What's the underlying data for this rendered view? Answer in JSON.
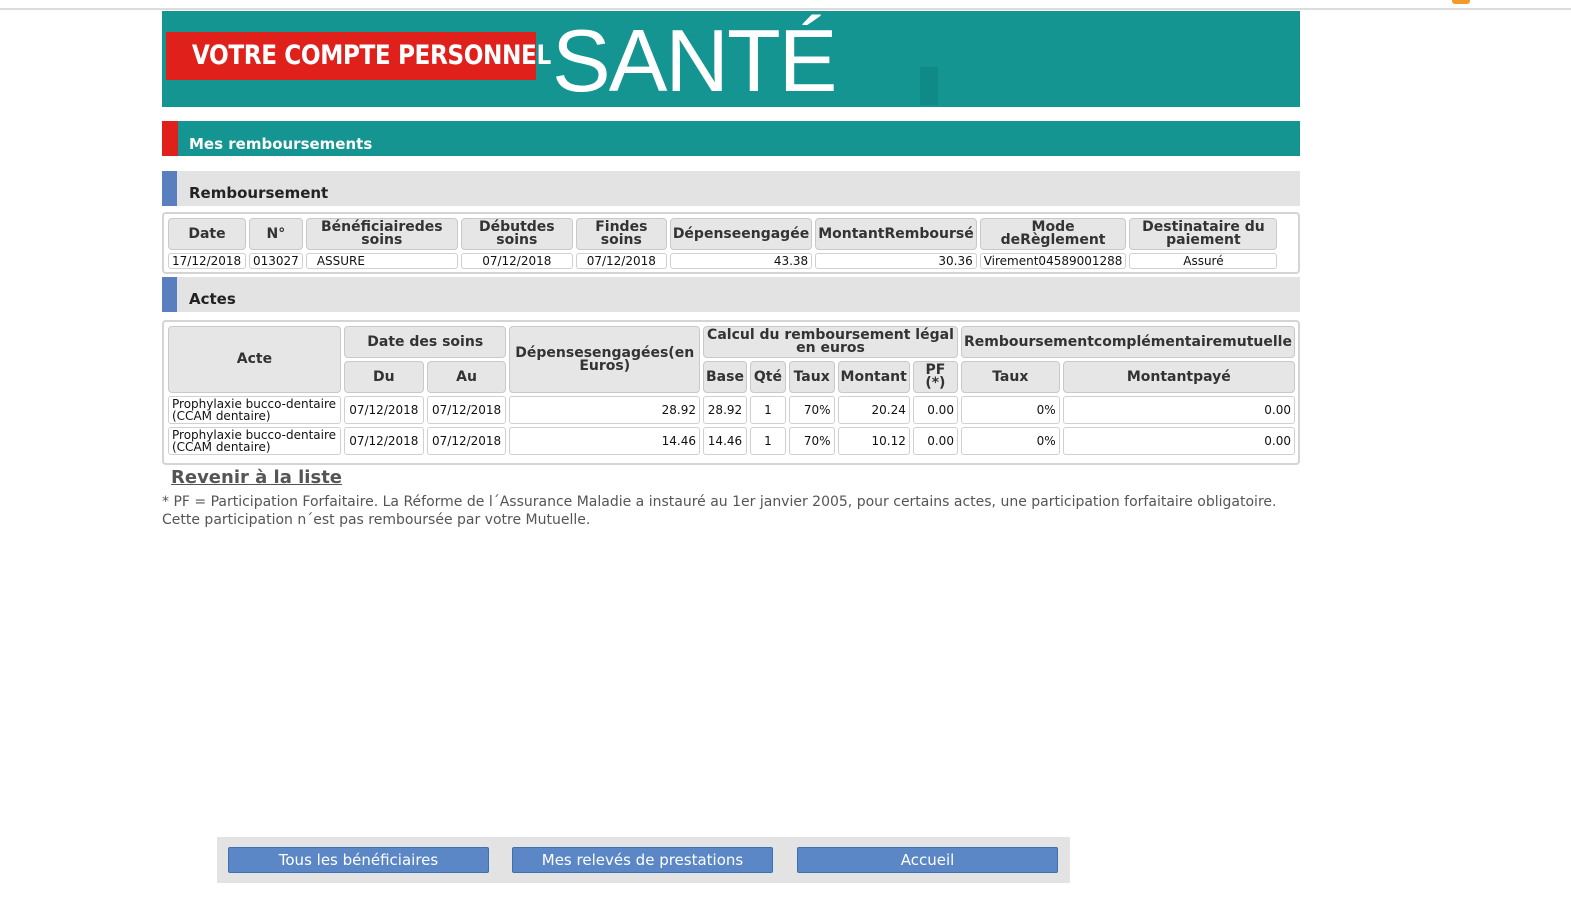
{
  "banner": {
    "compte_label": "VOTRE COMPTE PERSONNEL",
    "sante_label": "SANTÉ"
  },
  "section_main": "Mes remboursements",
  "section_remboursement": "Remboursement",
  "section_actes": "Actes",
  "remboursement": {
    "headers": [
      "Date",
      "N°",
      "Bénéficiairedes soins",
      "Débutdes soins",
      "Findes soins",
      "Dépenseengagée",
      "MontantRemboursé",
      "Mode deRèglement",
      "Destinataire du paiement"
    ],
    "row": [
      "17/12/2018",
      "013027",
      "ASSURE",
      "07/12/2018",
      "07/12/2018",
      "43.38",
      "30.36",
      "Virement04589001288",
      "Assuré"
    ]
  },
  "actes": {
    "h_acte": "Acte",
    "h_date": "Date des soins",
    "h_du": "Du",
    "h_au": "Au",
    "h_depenses": "Dépensesengagées(en Euros)",
    "h_calcul": "Calcul du remboursement légal en euros",
    "h_base": "Base",
    "h_qte": "Qté",
    "h_taux": "Taux",
    "h_montant": "Montant",
    "h_pf": "PF (*)",
    "h_compl": "Remboursementcomplémentairemutuelle",
    "h_taux2": "Taux",
    "h_montantpaye": "Montantpayé",
    "rows": [
      [
        "Prophylaxie bucco-dentaire (CCAM dentaire)",
        "07/12/2018",
        "07/12/2018",
        "28.92",
        "28.92",
        "1",
        "70%",
        "20.24",
        "0.00",
        "0%",
        "0.00"
      ],
      [
        "Prophylaxie bucco-dentaire (CCAM dentaire)",
        "07/12/2018",
        "07/12/2018",
        "14.46",
        "14.46",
        "1",
        "70%",
        "10.12",
        "0.00",
        "0%",
        "0.00"
      ]
    ]
  },
  "back_link": "Revenir à la liste",
  "footnote": "* PF = Participation Forfaitaire. La Réforme de l´Assurance Maladie a instauré au 1er janvier 2005, pour certains actes, une participation forfaitaire obligatoire. Cette participation n´est pas remboursée par votre Mutuelle.",
  "buttons": {
    "beneficiaires": "Tous les bénéficiaires",
    "releves": "Mes relevés de prestations",
    "accueil": "Accueil"
  },
  "colors": {
    "teal": "#149592",
    "red": "#e0201b",
    "blue_mark": "#5a7fbf",
    "button": "#5b87c6"
  }
}
